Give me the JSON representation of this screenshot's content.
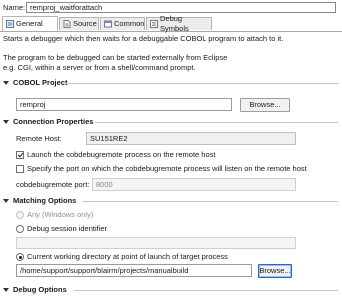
{
  "name": {
    "label": "Name:",
    "value": "remproj_waitforattach"
  },
  "tabs": [
    {
      "label": "General"
    },
    {
      "label": "Source"
    },
    {
      "label": "Common"
    },
    {
      "label": "Debug Symbols"
    }
  ],
  "intro": {
    "line1": "Starts a debugger which then waits for a debuggable COBOL program to attach to it.",
    "line2": "The program to be debugged can be started externally from Eclipse",
    "line3": "e.g. CGI, within a server or from a shell/command prompt."
  },
  "cobol_project": {
    "title": "COBOL Project",
    "value": "remproj",
    "browse_label": "Browse..."
  },
  "connection": {
    "title": "Connection Properties",
    "remote_host_label": "Remote Host:",
    "remote_host_value": "SU151RE2",
    "launch_label": "Launch the cobdebugremote process on the remote host",
    "launch_checked": true,
    "specify_port_label": "Specify the port on which the cobdebugremote process will listen on the remote host",
    "specify_port_checked": false,
    "port_label": "cobdebugremote port:",
    "port_value": "8000"
  },
  "matching": {
    "title": "Matching Options",
    "any_label": "Any (Windows only)",
    "session_label": "Debug session identifier",
    "session_value": "",
    "cwd_label": "Current working directory at point of launch of target process",
    "cwd_value": "/home/support/support/blairm/projects/manualbuild",
    "browse_label": "Browse..."
  },
  "debug_options": {
    "title": "Debug Options"
  }
}
